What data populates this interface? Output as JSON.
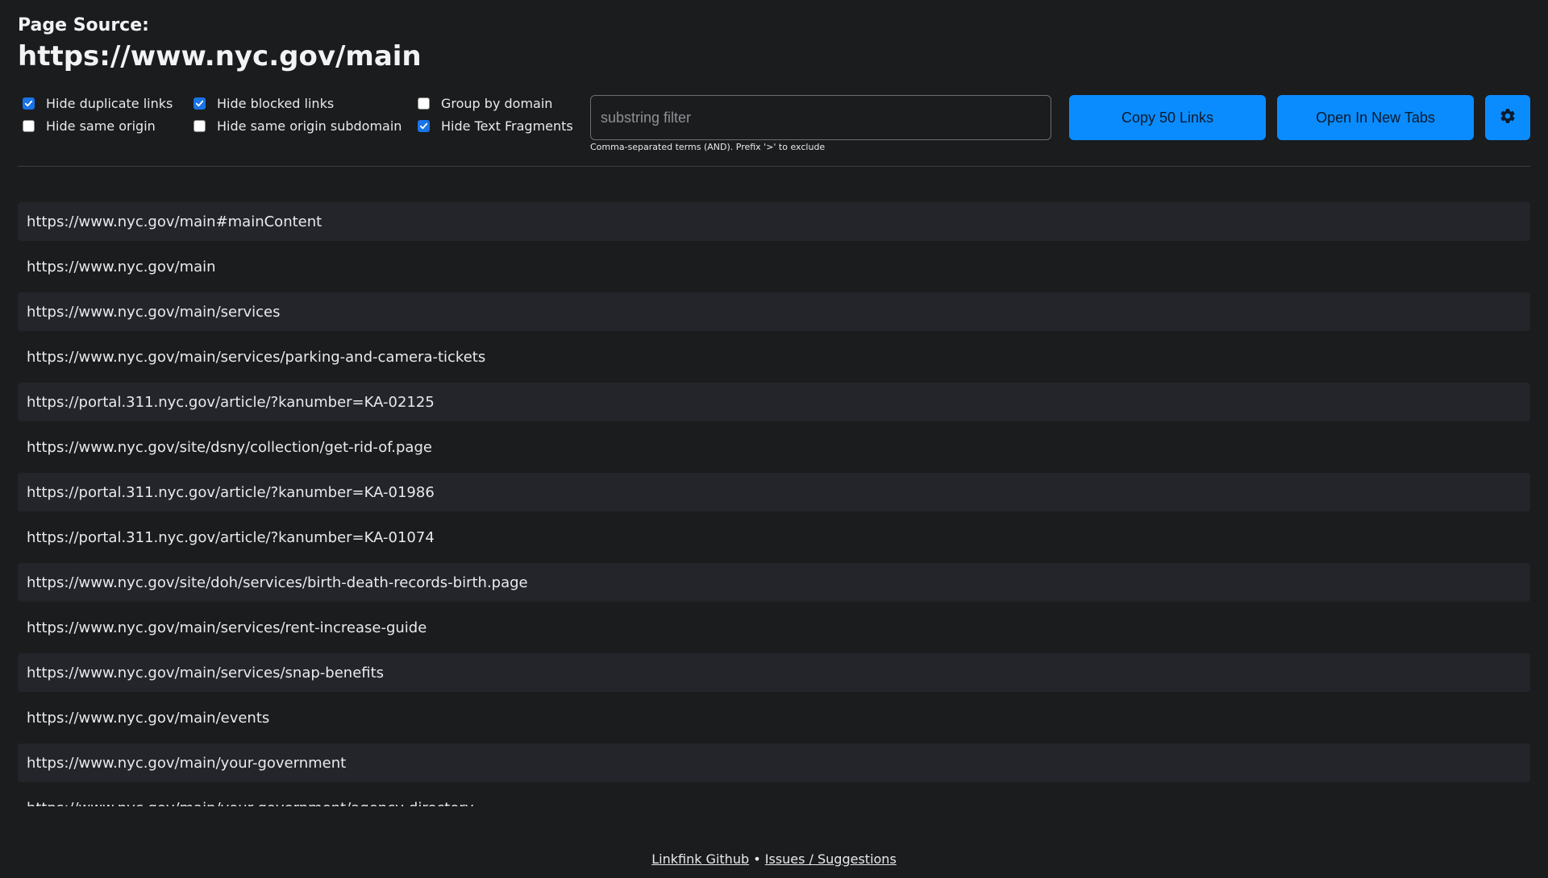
{
  "header": {
    "label": "Page Source:",
    "url": "https://www.nyc.gov/main"
  },
  "options": {
    "col1": [
      {
        "label": "Hide duplicate links",
        "checked": true
      },
      {
        "label": "Hide same origin",
        "checked": false
      }
    ],
    "col2": [
      {
        "label": "Hide blocked links",
        "checked": true
      },
      {
        "label": "Hide same origin subdomain",
        "checked": false
      }
    ],
    "col3": [
      {
        "label": "Group by domain",
        "checked": false
      },
      {
        "label": "Hide Text Fragments",
        "checked": true
      }
    ]
  },
  "filter": {
    "value": "",
    "placeholder": "substring filter",
    "hint": "Comma-separated terms (AND). Prefix '>' to exclude"
  },
  "toolbar": {
    "copy_label": "Copy 50 Links",
    "open_label": "Open In New Tabs",
    "settings_icon": "gear-icon"
  },
  "links": [
    "https://www.nyc.gov/main#mainContent",
    "https://www.nyc.gov/main",
    "https://www.nyc.gov/main/services",
    "https://www.nyc.gov/main/services/parking-and-camera-tickets",
    "https://portal.311.nyc.gov/article/?kanumber=KA-02125",
    "https://www.nyc.gov/site/dsny/collection/get-rid-of.page",
    "https://portal.311.nyc.gov/article/?kanumber=KA-01986",
    "https://portal.311.nyc.gov/article/?kanumber=KA-01074",
    "https://www.nyc.gov/site/doh/services/birth-death-records-birth.page",
    "https://www.nyc.gov/main/services/rent-increase-guide",
    "https://www.nyc.gov/main/services/snap-benefits",
    "https://www.nyc.gov/main/events",
    "https://www.nyc.gov/main/your-government",
    "https://www.nyc.gov/main/your-government/agency-directory"
  ],
  "footer": {
    "github_label": "Linkfink Github",
    "separator": "•",
    "issues_label": "Issues / Suggestions"
  },
  "colors": {
    "background": "#1b1c1d",
    "accent": "#0a8cff",
    "row_alt": "#23252a",
    "checkbox_on": "#1a73e8"
  }
}
